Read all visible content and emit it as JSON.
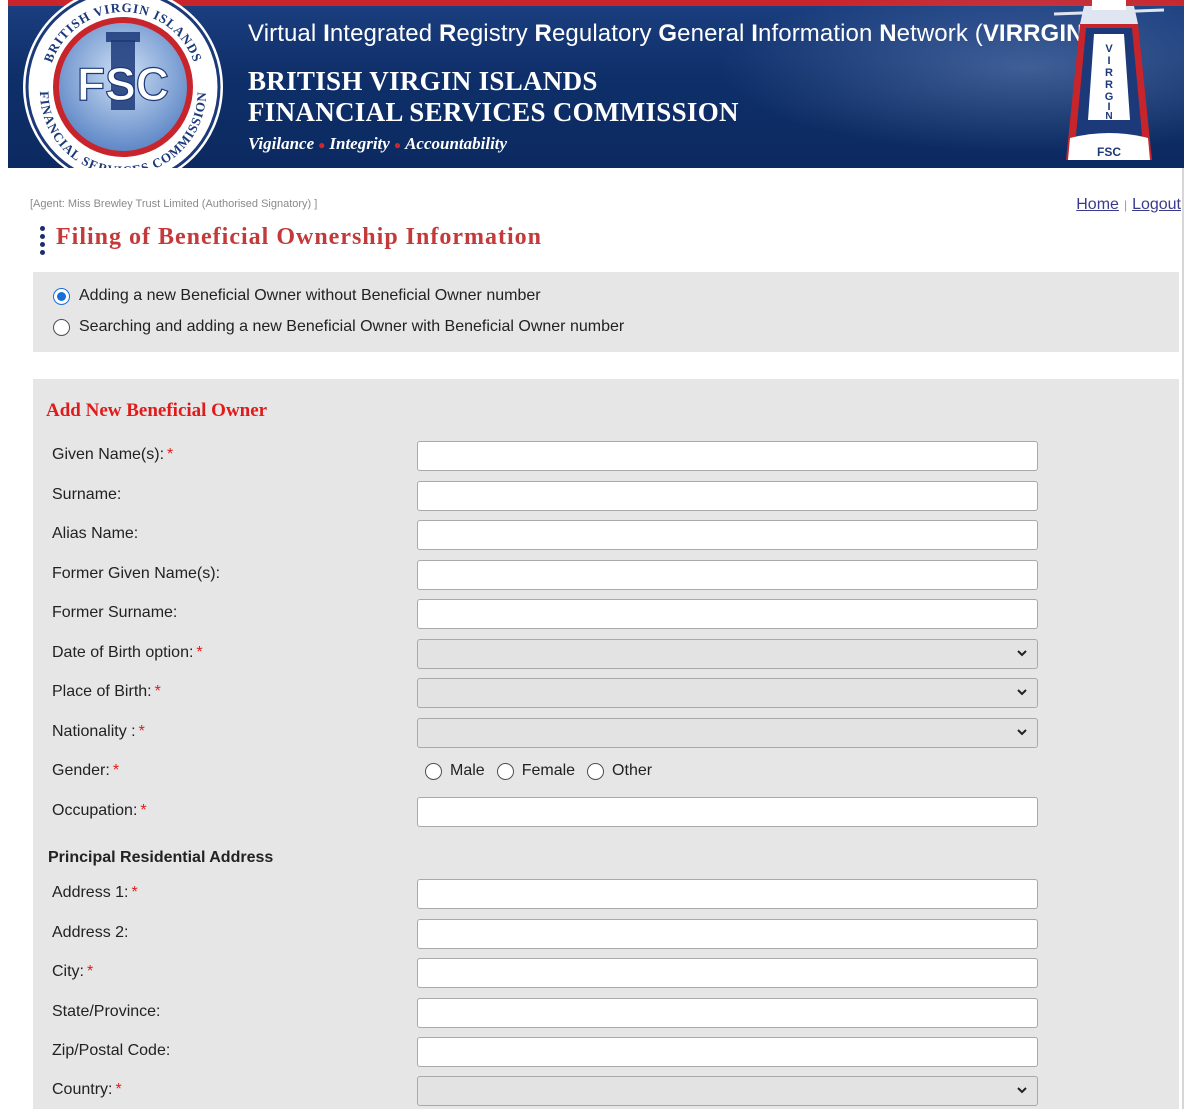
{
  "header": {
    "system_title_parts": [
      {
        "text": "V",
        "bold": false
      },
      {
        "text": "irtual ",
        "bold": false
      },
      {
        "text": "I",
        "bold": true
      },
      {
        "text": "ntegrated ",
        "bold": false
      },
      {
        "text": "R",
        "bold": true
      },
      {
        "text": "egistry ",
        "bold": false
      },
      {
        "text": "R",
        "bold": true
      },
      {
        "text": "egulatory ",
        "bold": false
      },
      {
        "text": "G",
        "bold": true
      },
      {
        "text": "eneral ",
        "bold": false
      },
      {
        "text": "I",
        "bold": true
      },
      {
        "text": "nformation ",
        "bold": false
      },
      {
        "text": "N",
        "bold": true
      },
      {
        "text": "etwork (",
        "bold": false
      },
      {
        "text": "VIRRGIN",
        "bold": true
      },
      {
        "text": ")",
        "bold": false
      }
    ],
    "org_line1": "BRITISH VIRGIN ISLANDS",
    "org_line2": "FINANCIAL SERVICES COMMISSION",
    "motto": [
      "Vigilance",
      "Integrity",
      "Accountability"
    ],
    "seal_text_top": "BRITISH VIRGIN ISLANDS",
    "seal_text_bottom": "FINANCIAL SERVICES COMMISSION",
    "seal_abbr": "FSC",
    "lighthouse_text": "VIRRGIN",
    "lighthouse_abbr": "FSC"
  },
  "topbar": {
    "agent": "[Agent: Miss Brewley Trust Limited (Authorised Signatory) ]",
    "home": "Home",
    "separator": "|",
    "logout": "Logout"
  },
  "page_title": "Filing of Beneficial Ownership Information",
  "options": [
    {
      "label": "Adding a new Beneficial Owner without Beneficial Owner number",
      "checked": true
    },
    {
      "label": "Searching and adding a new Beneficial Owner with Beneficial Owner number",
      "checked": false
    }
  ],
  "form": {
    "section_title": "Add New Beneficial Owner",
    "required_marker": "*",
    "fields": {
      "given_names": {
        "label": "Given Name(s):",
        "value": ""
      },
      "surname": {
        "label": "Surname:",
        "value": ""
      },
      "alias_name": {
        "label": "Alias Name:",
        "value": ""
      },
      "former_given_names": {
        "label": "Former Given Name(s):",
        "value": ""
      },
      "former_surname": {
        "label": "Former Surname:",
        "value": ""
      },
      "dob_option": {
        "label": "Date of Birth option:",
        "value": ""
      },
      "place_of_birth": {
        "label": "Place of Birth:",
        "value": ""
      },
      "nationality": {
        "label": "Nationality :",
        "value": ""
      },
      "gender": {
        "label": "Gender:",
        "options": [
          "Male",
          "Female",
          "Other"
        ],
        "selected": ""
      },
      "occupation": {
        "label": "Occupation:",
        "value": ""
      }
    },
    "address_heading": "Principal Residential Address",
    "address": {
      "address1": {
        "label": "Address 1:",
        "value": ""
      },
      "address2": {
        "label": "Address 2:",
        "value": ""
      },
      "city": {
        "label": "City:",
        "value": ""
      },
      "state": {
        "label": "State/Province:",
        "value": ""
      },
      "zip": {
        "label": "Zip/Postal Code:",
        "value": ""
      },
      "country": {
        "label": "Country:",
        "value": ""
      }
    }
  },
  "colors": {
    "banner_blue": "#0f2f6a",
    "banner_red": "#c8242b",
    "title_red": "#c33a3a",
    "section_red": "#e01b1b",
    "panel_gray": "#e6e6e6",
    "radio_blue": "#1a6fd6"
  }
}
